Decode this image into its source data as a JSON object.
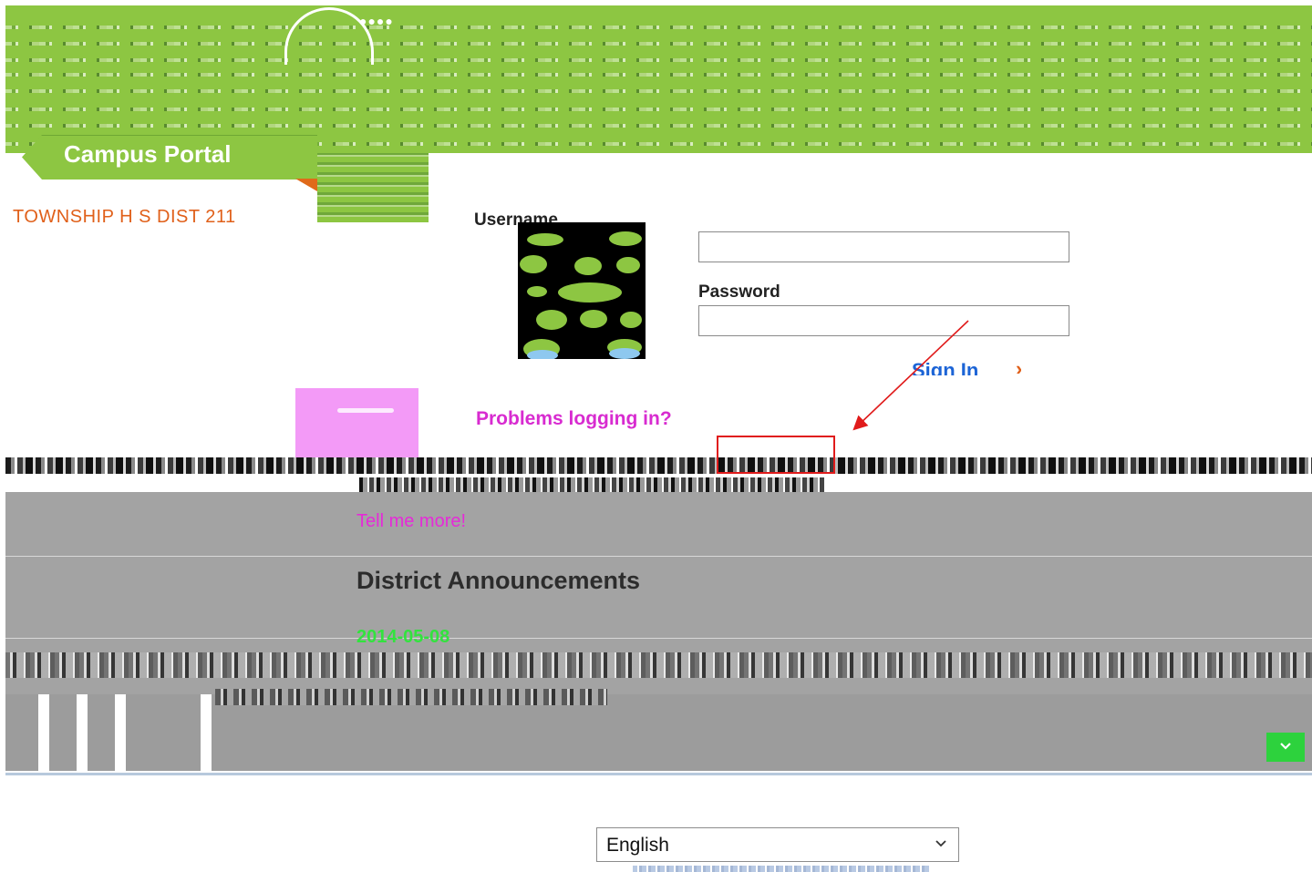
{
  "portal": {
    "tab_title": "Campus Portal",
    "district_name": "TOWNSHIP H S DIST 211"
  },
  "login": {
    "username_label": "Username",
    "password_label": "Password",
    "username_value": "",
    "password_value": "",
    "sign_in_label": "Sign In",
    "sign_in_chevrons": "»",
    "problems_link": "Problems logging in?"
  },
  "announcements": {
    "tell_more_link": "Tell me more!",
    "section_title": "District Announcements",
    "date": "2014-05-08"
  },
  "language_select": {
    "selected": "English"
  },
  "icons": {
    "scroll_down": "chevron-down-icon",
    "select_caret": "chevron-down-icon",
    "annotation": "red-arrow-annotation"
  },
  "colors": {
    "brand_green": "#8dc642",
    "accent_orange": "#e0601a",
    "link_magenta": "#d82bd0",
    "signin_blue": "#1c64d6",
    "date_green": "#32e33e",
    "annotation_red": "#e01b1b",
    "panel_gray": "#a3a3a3"
  }
}
